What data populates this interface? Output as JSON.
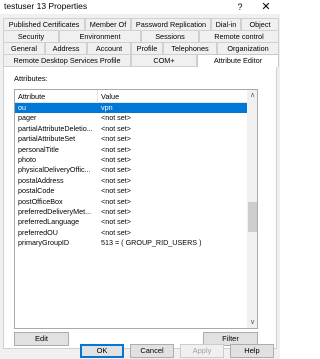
{
  "window": {
    "title": "testuser 13 Properties",
    "help_glyph": "?",
    "close_glyph": "✕"
  },
  "tabs": {
    "row1": [
      "Published Certificates",
      "Member Of",
      "Password Replication",
      "Dial-in",
      "Object"
    ],
    "row2": [
      "Security",
      "Environment",
      "Sessions",
      "Remote control"
    ],
    "row3": [
      "General",
      "Address",
      "Account",
      "Profile",
      "Telephones",
      "Organization"
    ],
    "row4": [
      "Remote Desktop Services Profile",
      "COM+",
      "Attribute Editor"
    ],
    "active": "Attribute Editor"
  },
  "attributes": {
    "label": "Attributes:",
    "columns": {
      "attribute": "Attribute",
      "value": "Value"
    },
    "rows": [
      {
        "attribute": "ou",
        "value": "vpn",
        "selected": true
      },
      {
        "attribute": "pager",
        "value": "<not set>"
      },
      {
        "attribute": "partialAttributeDeletio...",
        "value": "<not set>"
      },
      {
        "attribute": "partialAttributeSet",
        "value": "<not set>"
      },
      {
        "attribute": "personalTitle",
        "value": "<not set>"
      },
      {
        "attribute": "photo",
        "value": "<not set>"
      },
      {
        "attribute": "physicalDeliveryOffic...",
        "value": "<not set>"
      },
      {
        "attribute": "postalAddress",
        "value": "<not set>"
      },
      {
        "attribute": "postalCode",
        "value": "<not set>"
      },
      {
        "attribute": "postOfficeBox",
        "value": "<not set>"
      },
      {
        "attribute": "preferredDeliveryMet...",
        "value": "<not set>"
      },
      {
        "attribute": "preferredLanguage",
        "value": "<not set>"
      },
      {
        "attribute": "preferredOU",
        "value": "<not set>"
      },
      {
        "attribute": "primaryGroupID",
        "value": "513 = ( GROUP_RID_USERS )"
      }
    ],
    "scroll_up_glyph": "∧",
    "scroll_down_glyph": "∨"
  },
  "buttons": {
    "edit": "Edit",
    "filter": "Filter",
    "ok": "OK",
    "cancel": "Cancel",
    "apply": "Apply",
    "help": "Help"
  }
}
